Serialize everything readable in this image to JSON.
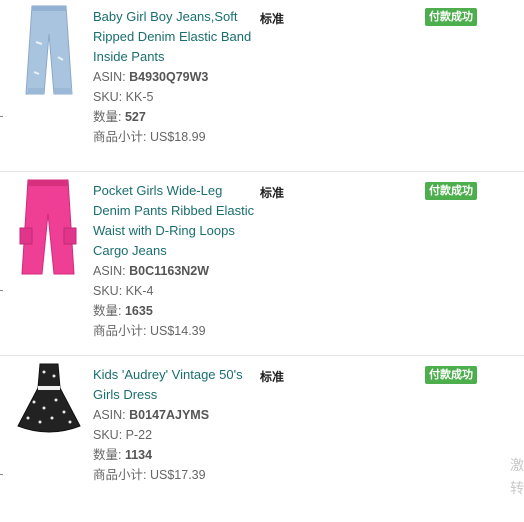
{
  "orders": [
    {
      "title": "Baby Girl Boy Jeans,Soft Ripped Denim Elastic Band Inside Pants",
      "asin_label": "ASIN:",
      "asin": "B4930Q79W3",
      "sku_label": "SKU:",
      "sku": "KK-5",
      "qty_label": "数量:",
      "qty": "527",
      "subtotal_label": "商品小计:",
      "subtotal": "US$18.99",
      "shipping": "标准",
      "status": "付款成功",
      "image": "denim-jeans-image"
    },
    {
      "title": "Pocket Girls Wide-Leg Denim Pants Ribbed Elastic Waist with D-Ring Loops Cargo Jeans",
      "asin_label": "ASIN:",
      "asin": "B0C1163N2W",
      "sku_label": "SKU:",
      "sku": "KK-4",
      "qty_label": "数量:",
      "qty": "1635",
      "subtotal_label": "商品小计:",
      "subtotal": "US$14.39",
      "shipping": "标准",
      "status": "付款成功",
      "image": "pink-cargo-pants-image"
    },
    {
      "title": "Kids 'Audrey' Vintage 50's Girls Dress",
      "asin_label": "ASIN:",
      "asin": "B0147AJYMS",
      "sku_label": "SKU:",
      "sku": "P-22",
      "qty_label": "数量:",
      "qty": "1134",
      "subtotal_label": "商品小计:",
      "subtotal": "US$17.39",
      "shipping": "标准",
      "status": "付款成功",
      "image": "polka-dot-dress-image"
    }
  ],
  "watermark": [
    "激",
    "转"
  ],
  "colors": {
    "status_green": "#4cae4c",
    "title_teal": "#1a6e6e",
    "pink": "#ee3f95"
  }
}
